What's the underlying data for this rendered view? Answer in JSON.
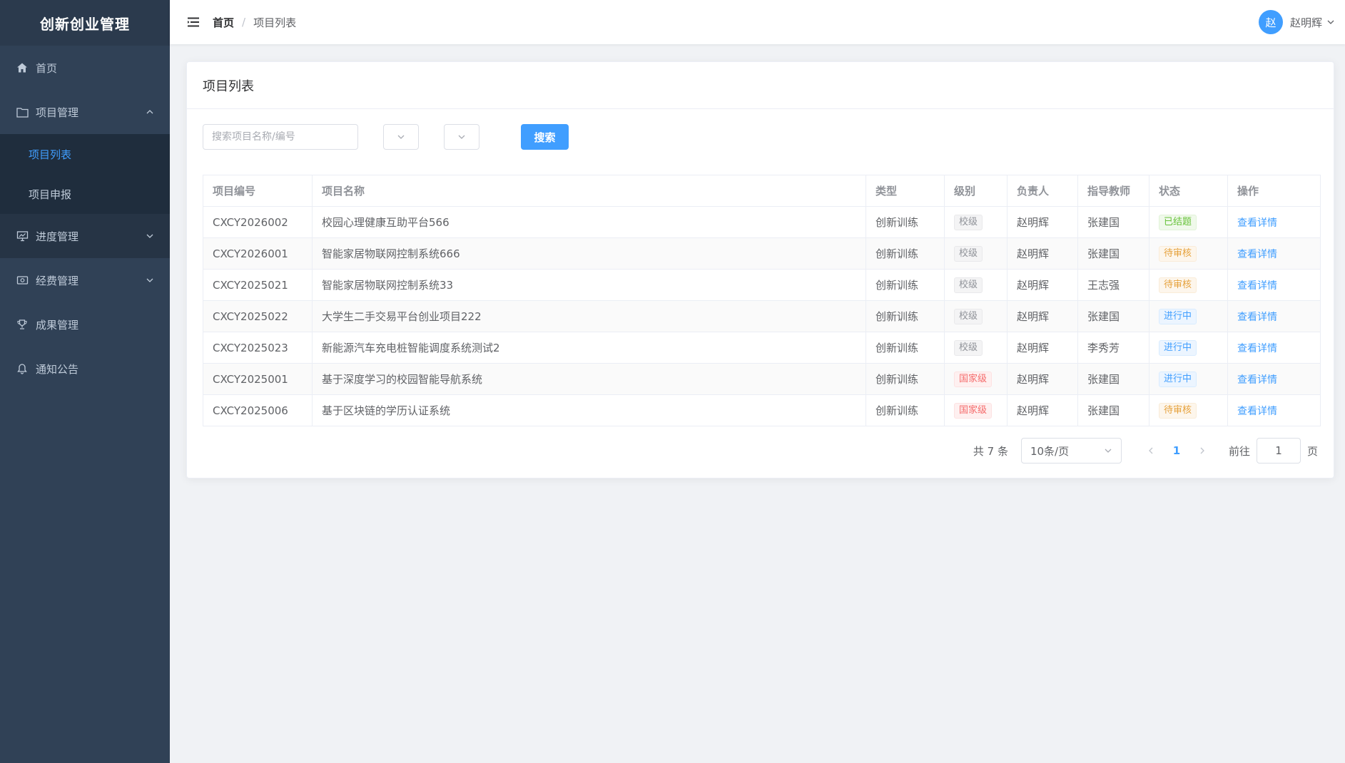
{
  "sidebar": {
    "brand": "创新创业管理",
    "items": [
      {
        "label": "首页",
        "icon": "home-icon"
      },
      {
        "label": "项目管理",
        "icon": "folder-icon",
        "expanded": true,
        "children": [
          {
            "label": "项目列表",
            "active": true
          },
          {
            "label": "项目申报"
          }
        ]
      },
      {
        "label": "进度管理",
        "icon": "presentation-icon"
      },
      {
        "label": "经费管理",
        "icon": "money-icon"
      },
      {
        "label": "成果管理",
        "icon": "trophy-icon"
      },
      {
        "label": "通知公告",
        "icon": "bell-icon"
      }
    ]
  },
  "header": {
    "breadcrumb_home": "首页",
    "breadcrumb_sep": "/",
    "breadcrumb_current": "项目列表",
    "avatar_text": "赵",
    "user_name": "赵明辉"
  },
  "card": {
    "title": "项目列表",
    "search_placeholder": "搜索项目名称/编号",
    "search_button": "搜索"
  },
  "table": {
    "headers": [
      "项目编号",
      "项目名称",
      "类型",
      "级别",
      "负责人",
      "指导教师",
      "状态",
      "操作"
    ],
    "rows": [
      {
        "id": "CXCY2026002",
        "name": "校园心理健康互助平台566",
        "type": "创新训练",
        "level": "校级",
        "level_color": "gray",
        "leader": "赵明辉",
        "teacher": "张建国",
        "status": "已结题",
        "status_color": "green",
        "action": "查看详情"
      },
      {
        "id": "CXCY2026001",
        "name": "智能家居物联网控制系统666",
        "type": "创新训练",
        "level": "校级",
        "level_color": "gray",
        "leader": "赵明辉",
        "teacher": "张建国",
        "status": "待审核",
        "status_color": "orange",
        "action": "查看详情"
      },
      {
        "id": "CXCY2025021",
        "name": "智能家居物联网控制系统33",
        "type": "创新训练",
        "level": "校级",
        "level_color": "gray",
        "leader": "赵明辉",
        "teacher": "王志强",
        "status": "待审核",
        "status_color": "orange",
        "action": "查看详情"
      },
      {
        "id": "CXCY2025022",
        "name": "大学生二手交易平台创业项目222",
        "type": "创新训练",
        "level": "校级",
        "level_color": "gray",
        "leader": "赵明辉",
        "teacher": "张建国",
        "status": "进行中",
        "status_color": "blue",
        "action": "查看详情"
      },
      {
        "id": "CXCY2025023",
        "name": "新能源汽车充电桩智能调度系统测试2",
        "type": "创新训练",
        "level": "校级",
        "level_color": "gray",
        "leader": "赵明辉",
        "teacher": "李秀芳",
        "status": "进行中",
        "status_color": "blue",
        "action": "查看详情"
      },
      {
        "id": "CXCY2025001",
        "name": "基于深度学习的校园智能导航系统",
        "type": "创新训练",
        "level": "国家级",
        "level_color": "red",
        "leader": "赵明辉",
        "teacher": "张建国",
        "status": "进行中",
        "status_color": "blue",
        "action": "查看详情"
      },
      {
        "id": "CXCY2025006",
        "name": "基于区块链的学历认证系统",
        "type": "创新训练",
        "level": "国家级",
        "level_color": "red",
        "leader": "赵明辉",
        "teacher": "张建国",
        "status": "待审核",
        "status_color": "orange",
        "action": "查看详情"
      }
    ]
  },
  "pagination": {
    "total_text": "共 7 条",
    "page_size": "10条/页",
    "current_page": "1",
    "goto_label": "前往",
    "goto_value": "1",
    "page_suffix": "页"
  },
  "colors": {
    "sidebar_bg": "#304156",
    "accent": "#409eff"
  }
}
